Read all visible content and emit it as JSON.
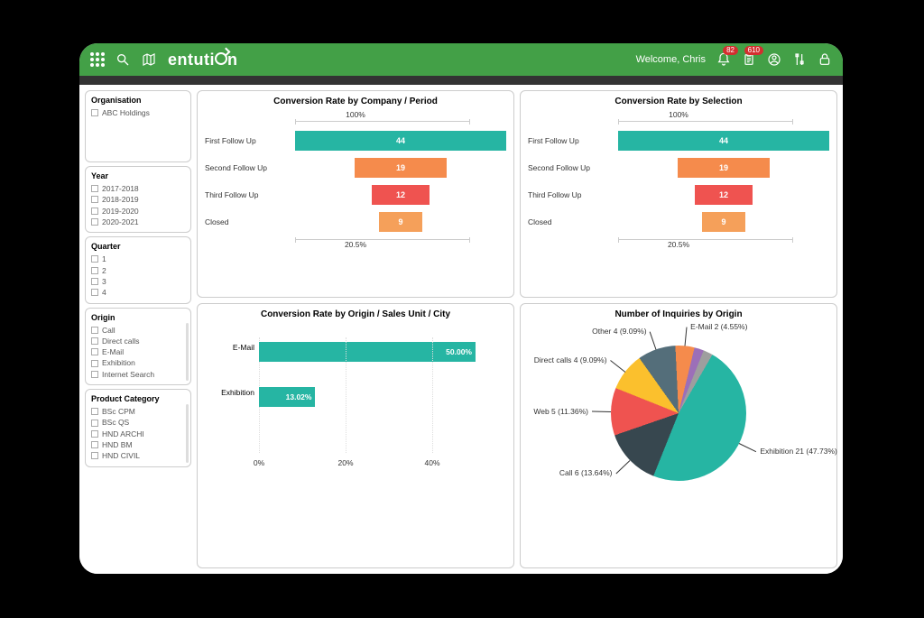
{
  "header": {
    "welcome": "Welcome, Chris",
    "brand": "entution",
    "badges": {
      "bell": "82",
      "clipboard": "610"
    }
  },
  "sidebar": {
    "organisation": {
      "title": "Organisation",
      "items": [
        "ABC Holdings"
      ]
    },
    "year": {
      "title": "Year",
      "items": [
        "2017-2018",
        "2018-2019",
        "2019-2020",
        "2020-2021"
      ]
    },
    "quarter": {
      "title": "Quarter",
      "items": [
        "1",
        "2",
        "3",
        "4"
      ]
    },
    "origin": {
      "title": "Origin",
      "items": [
        "Call",
        "Direct calls",
        "E-Mail",
        "Exhibition",
        "Internet Search"
      ]
    },
    "product": {
      "title": "Product Category",
      "items": [
        "BSc CPM",
        "BSc QS",
        "HND ARCHI",
        "HND BM",
        "HND CIVIL"
      ]
    }
  },
  "cards": {
    "funnel1": {
      "title": "Conversion Rate by Company / Period",
      "top": "100%",
      "bottom": "20.5%"
    },
    "funnel2": {
      "title": "Conversion Rate by Selection",
      "top": "100%",
      "bottom": "20.5%"
    },
    "hbar": {
      "title": "Conversion Rate by Origin / Sales Unit / City"
    },
    "pie": {
      "title": "Number of Inquiries by Origin"
    }
  },
  "chart_data": [
    {
      "type": "bar",
      "layout": "funnel",
      "title": "Conversion Rate by Company / Period",
      "top_label": "100%",
      "bottom_label": "20.5%",
      "categories": [
        "First Follow Up",
        "Second Follow Up",
        "Third Follow Up",
        "Closed"
      ],
      "values": [
        44,
        19,
        12,
        9
      ],
      "colors": [
        "#26b5a3",
        "#f58b4c",
        "#ef5350",
        "#f5a05a"
      ]
    },
    {
      "type": "bar",
      "layout": "funnel",
      "title": "Conversion Rate by Selection",
      "top_label": "100%",
      "bottom_label": "20.5%",
      "categories": [
        "First Follow Up",
        "Second Follow Up",
        "Third Follow Up",
        "Closed"
      ],
      "values": [
        44,
        19,
        12,
        9
      ],
      "colors": [
        "#26b5a3",
        "#f58b4c",
        "#ef5350",
        "#f5a05a"
      ]
    },
    {
      "type": "bar",
      "layout": "horizontal",
      "title": "Conversion Rate by Origin / Sales Unit / City",
      "categories": [
        "E-Mail",
        "Exhibition"
      ],
      "values": [
        50.0,
        13.02
      ],
      "value_labels": [
        "50.00%",
        "13.02%"
      ],
      "xticks": [
        "0%",
        "20%",
        "40%"
      ],
      "xtick_positions": [
        0,
        20,
        40
      ],
      "xrange": [
        0,
        55
      ],
      "bar_color": "#26b5a3"
    },
    {
      "type": "pie",
      "title": "Number of Inquiries by Origin",
      "series": [
        {
          "name": "Exhibition",
          "value": 21,
          "pct": 47.73,
          "label": "Exhibition 21 (47.73%)",
          "color": "#26b5a3"
        },
        {
          "name": "Call",
          "value": 6,
          "pct": 13.64,
          "label": "Call 6 (13.64%)",
          "color": "#37474f"
        },
        {
          "name": "Web",
          "value": 5,
          "pct": 11.36,
          "label": "Web 5 (11.36%)",
          "color": "#ef5350"
        },
        {
          "name": "Direct calls",
          "value": 4,
          "pct": 9.09,
          "label": "Direct calls 4 (9.09%)",
          "color": "#fbc02d"
        },
        {
          "name": "Other",
          "value": 4,
          "pct": 9.09,
          "label": "Other 4 (9.09%)",
          "color": "#546e7a"
        },
        {
          "name": "E-Mail",
          "value": 2,
          "pct": 4.55,
          "label": "E-Mail 2 (4.55%)",
          "color": "#f58b4c"
        },
        {
          "name": "SliceA",
          "value": 1,
          "pct": 2.27,
          "label": "",
          "color": "#9c6fb8"
        },
        {
          "name": "SliceB",
          "value": 1,
          "pct": 2.27,
          "label": "",
          "color": "#9e9e9e"
        }
      ]
    }
  ]
}
